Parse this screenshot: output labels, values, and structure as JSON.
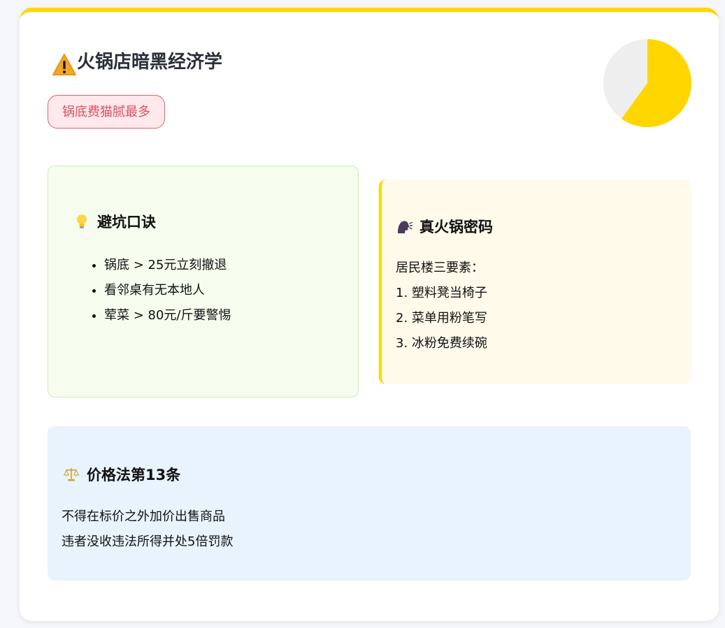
{
  "header": {
    "title": "火锅店暗黑经济学",
    "badge": "锅底费猫腻最多",
    "title_icon": "warning-icon"
  },
  "pie": {
    "value_fraction": 0.6,
    "colors": {
      "filled": "#ffd600",
      "rest": "#eeeeee"
    }
  },
  "tips": {
    "icon": "lightbulb-icon",
    "heading": "避坑口诀",
    "items": [
      "锅底 > 25元立刻撤退",
      "看邻桌有无本地人",
      "荤菜 > 80元/斤要警惕"
    ]
  },
  "secret": {
    "icon": "speaking-head-icon",
    "heading": "真火锅密码",
    "lines": [
      "居民楼三要素：",
      "1. 塑料凳当椅子",
      "2. 菜单用粉笔写",
      "3. 冰粉免费续碗"
    ]
  },
  "law": {
    "icon": "balance-scale-icon",
    "heading": "价格法第13条",
    "lines": [
      "不得在标价之外加价出售商品",
      "违者没收违法所得并处5倍罚款"
    ]
  },
  "colors": {
    "accent": "#ffd600",
    "badge_text": "#d9515e",
    "tips_bg": "#f6fdee",
    "secret_bg": "#fffaea",
    "law_bg": "#e9f3fd"
  }
}
